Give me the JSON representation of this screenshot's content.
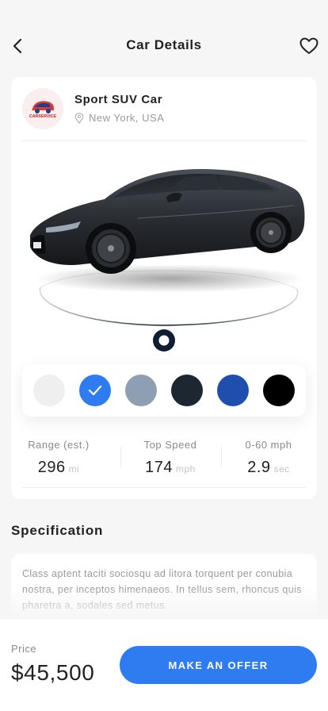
{
  "header": {
    "title": "Car Details",
    "back_icon": "chevron-left-icon",
    "favorite_icon": "heart-outline-icon"
  },
  "car": {
    "name": "Sport SUV Car",
    "location": "New York, USA",
    "logo_text": "CARSERVICE"
  },
  "colors": {
    "options": [
      "#f0eff0",
      "#2f7cf0",
      "#8e9fb4",
      "#1d2731",
      "#1e4fae",
      "#000000"
    ],
    "selected_index": 1
  },
  "stats": [
    {
      "label": "Range (est.)",
      "value": "296",
      "unit": "mi"
    },
    {
      "label": "Top Speed",
      "value": "174",
      "unit": "mph"
    },
    {
      "label": "0-60 mph",
      "value": "2.9",
      "unit": "sec"
    }
  ],
  "specification": {
    "title": "Specification",
    "text": "Class aptent taciti sociosqu ad litora torquent per conubia nostra, per inceptos himenaeos. In tellus sem, rhoncus quis pharetra a, sodales sed metus."
  },
  "bottom": {
    "price_label": "Price",
    "price": "$45,500",
    "offer_label": "MAKE AN OFFER"
  },
  "theme": {
    "accent": "#2f7cf0"
  }
}
